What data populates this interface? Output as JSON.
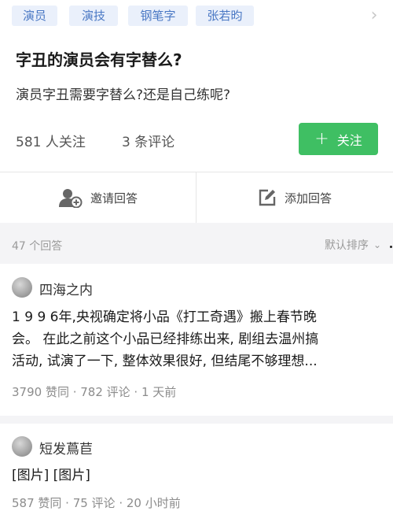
{
  "tags": {
    "items": [
      {
        "label": "演员"
      },
      {
        "label": "演技"
      },
      {
        "label": "钢笔字"
      },
      {
        "label": "张若昀"
      }
    ],
    "more_icon": "chevron-right-icon"
  },
  "question": {
    "title": "字丑的演员会有字替么?",
    "description": "演员字丑需要字替么?还是自己练呢?",
    "followers": "581 人关注",
    "comments": "3 条评论",
    "follow_label": "关注",
    "follow_icon": "plus-icon"
  },
  "actions": {
    "invite_label": "邀请回答",
    "invite_icon": "invite-user-icon",
    "write_label": "添加回答",
    "write_icon": "edit-icon"
  },
  "answers_header": {
    "count": "47 个回答",
    "sort_label": "默认排序",
    "sort_icon": "chevron-down-icon"
  },
  "answers": [
    {
      "author": "四海之内",
      "lines": [
        "1 9 9 6年,央视确定将小品《打工奇遇》搬上春节晚",
        "会。 在此之前这个小品已经排练出来, 剧组去温州搞",
        "活动, 试演了一下, 整体效果很好, 但结尾不够理想..."
      ],
      "meta": "3790 赞同 · 782 评论 · 1 天前"
    },
    {
      "author": "短发蔦苣",
      "lines": [
        "[图片] [图片]"
      ],
      "meta": "587 赞同 · 75 评论 · 20 小时前"
    }
  ],
  "colors": {
    "accent_green": "#3fbf63",
    "tag_bg": "#eaf0fb",
    "tag_text": "#4a78c4",
    "band_bg": "#f4f4f6"
  }
}
